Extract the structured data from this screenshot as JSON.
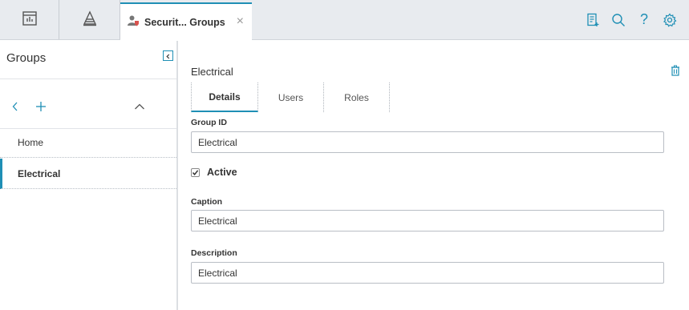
{
  "topbar": {
    "tab": {
      "title": "Securit... Groups"
    },
    "icons": [
      "dashboard-icon",
      "hierarchy-icon",
      "security-user-icon",
      "close-icon",
      "new-record-icon",
      "search-icon",
      "help-icon",
      "settings-icon"
    ],
    "help_glyph": "?",
    "close_glyph": "×"
  },
  "sidebar": {
    "title": "Groups",
    "items": [
      {
        "label": "Home",
        "selected": false
      },
      {
        "label": "Electrical",
        "selected": true
      }
    ]
  },
  "main": {
    "title": "Electrical",
    "tabs": [
      {
        "label": "Details",
        "active": true
      },
      {
        "label": "Users",
        "active": false
      },
      {
        "label": "Roles",
        "active": false
      }
    ],
    "group_id": {
      "label": "Group ID",
      "value": "Electrical"
    },
    "active": {
      "label": "Active",
      "checked": true
    },
    "caption": {
      "label": "Caption",
      "value": "Electrical"
    },
    "description": {
      "label": "Description",
      "value": "Electrical"
    }
  },
  "colors": {
    "accent": "#1f8fb5",
    "topbar_bg": "#e8ebef",
    "security_icon_red": "#d9534f"
  }
}
